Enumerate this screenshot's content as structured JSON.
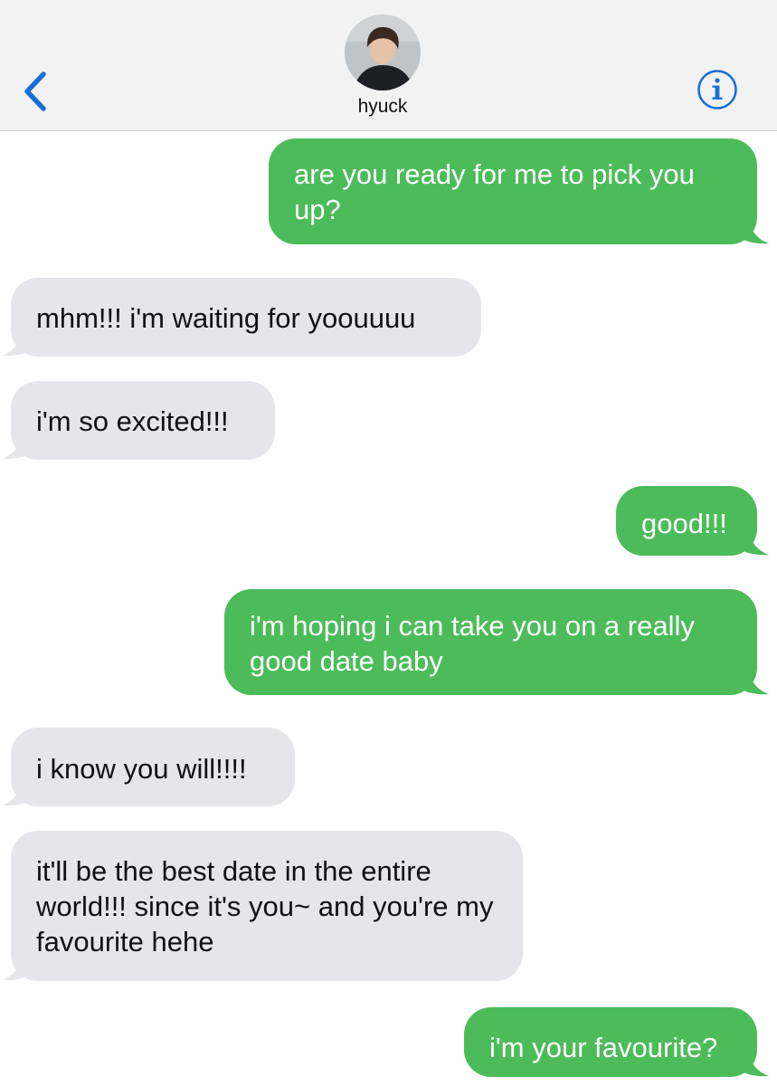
{
  "header": {
    "contact_name": "hyuck",
    "back_icon": "chevron-left-icon",
    "info_icon": "info-circle-icon",
    "accent_color": "#1a6ed8"
  },
  "conversation": {
    "sent_color": "#4cbc5a",
    "received_color": "#e6e5ea",
    "messages": [
      {
        "direction": "sent",
        "text": "are you ready for me to pick you up?"
      },
      {
        "direction": "received",
        "text": "mhm!!! i'm waiting for yoouuuu"
      },
      {
        "direction": "received",
        "text": "i'm so excited!!!"
      },
      {
        "direction": "sent",
        "text": "good!!!"
      },
      {
        "direction": "sent",
        "text": "i'm hoping i can take you on a really good date baby"
      },
      {
        "direction": "received",
        "text": "i know you will!!!!"
      },
      {
        "direction": "received",
        "text": "it'll be the best date in the entire world!!! since it's you~ and you're my favourite hehe"
      },
      {
        "direction": "sent",
        "text": "i'm your favourite?"
      }
    ]
  }
}
